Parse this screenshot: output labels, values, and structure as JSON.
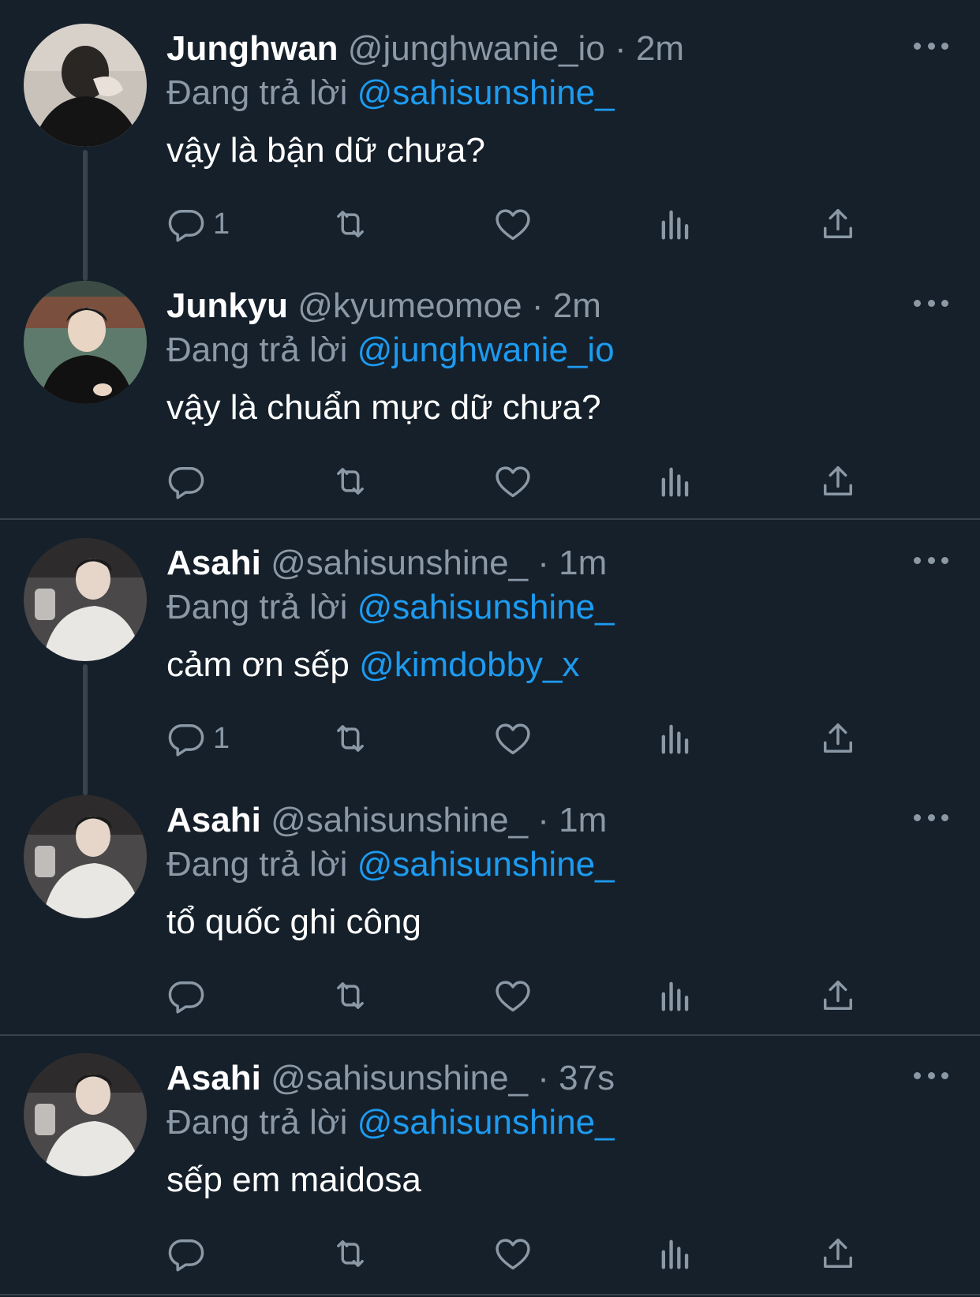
{
  "tweets": [
    {
      "display_name": "Junghwan",
      "handle": "@junghwanie_io",
      "separator": "·",
      "time": "2m",
      "reply_prefix": "Đang trả lời",
      "reply_to": "@sahisunshine_",
      "text": "vậy là bận dữ chưa?",
      "text_mention": "",
      "reply_count": "1"
    },
    {
      "display_name": "Junkyu",
      "handle": "@kyumeomoe",
      "separator": "·",
      "time": "2m",
      "reply_prefix": "Đang trả lời",
      "reply_to": "@junghwanie_io",
      "text": "vậy là chuẩn mực dữ chưa?",
      "text_mention": "",
      "reply_count": ""
    },
    {
      "display_name": "Asahi",
      "handle": "@sahisunshine_",
      "separator": "·",
      "time": "1m",
      "reply_prefix": "Đang trả lời",
      "reply_to": "@sahisunshine_",
      "text": "cảm ơn sếp ",
      "text_mention": "@kimdobby_x",
      "reply_count": "1"
    },
    {
      "display_name": "Asahi",
      "handle": "@sahisunshine_",
      "separator": "·",
      "time": "1m",
      "reply_prefix": "Đang trả lời",
      "reply_to": "@sahisunshine_",
      "text": "tổ quốc ghi công",
      "text_mention": "",
      "reply_count": ""
    },
    {
      "display_name": "Asahi",
      "handle": "@sahisunshine_",
      "separator": "·",
      "time": "37s",
      "reply_prefix": "Đang trả lời",
      "reply_to": "@sahisunshine_",
      "text": "sếp em maidosa",
      "text_mention": "",
      "reply_count": ""
    }
  ],
  "icons": {
    "reply": "reply-icon",
    "retweet": "retweet-icon",
    "like": "heart-icon",
    "views": "analytics-icon",
    "share": "share-icon",
    "more": "more-icon"
  },
  "colors": {
    "background": "#15202b",
    "text": "#ffffff",
    "secondary": "#8b98a5",
    "accent": "#1d9bf0",
    "divider": "#38444d"
  }
}
